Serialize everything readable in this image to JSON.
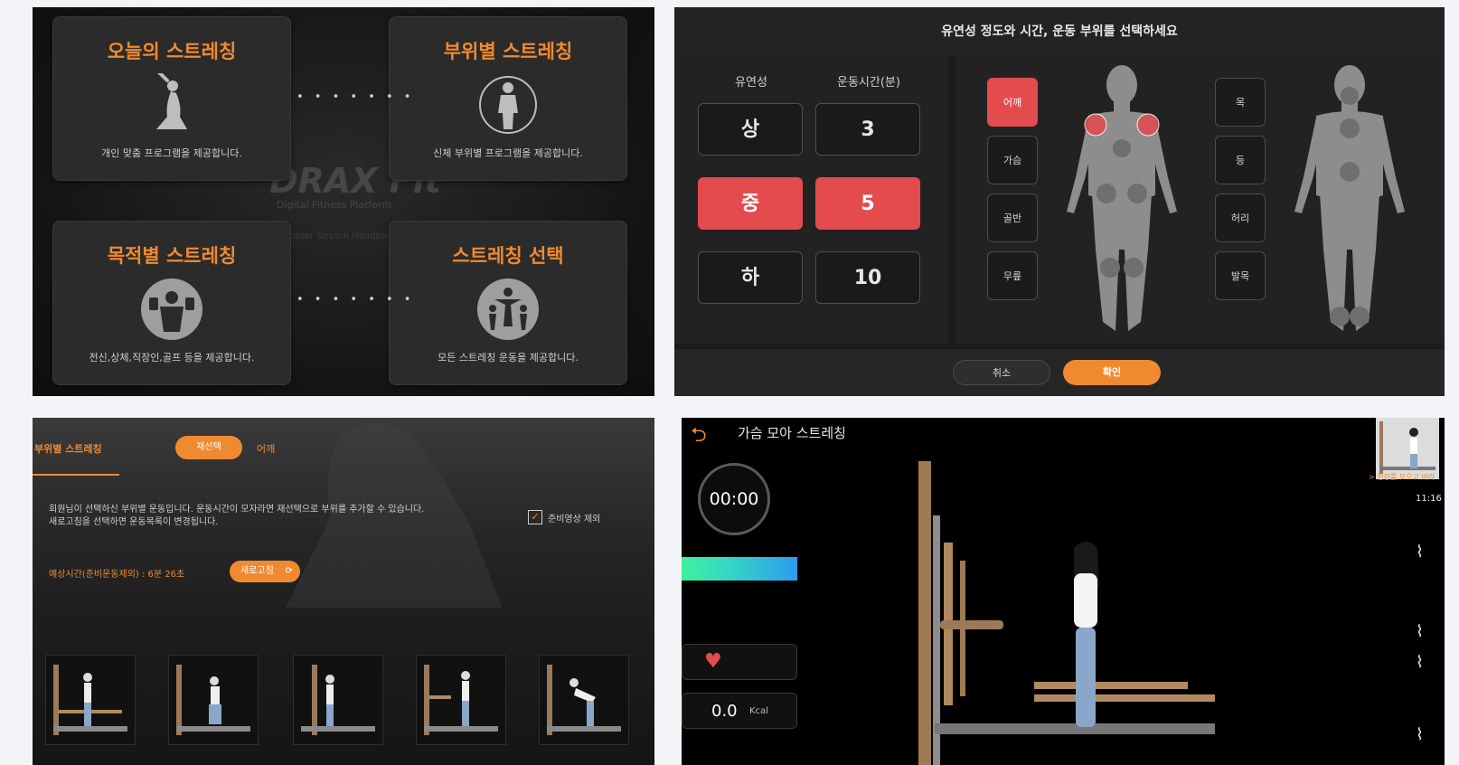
{
  "colors": {
    "accent_orange": "#f08a30",
    "accent_red": "#e34b4f",
    "panel_dark": "#1c1c1c"
  },
  "menu": {
    "cards": [
      {
        "title": "오늘의 스트레칭",
        "desc": "개인 맞춤 프로그램을 제공합니다.",
        "icon": "yoga-pose-icon"
      },
      {
        "title": "부위별 스트레칭",
        "desc": "신체 부위별 프로그램을 제공합니다.",
        "icon": "body-rotate-icon"
      },
      {
        "title": "목적별 스트레칭",
        "desc": "전신,상체,직장인,골프 등을 제공합니다.",
        "icon": "dumbbell-person-icon"
      },
      {
        "title": "스트레칭 선택",
        "desc": "모든 스트레칭 운동을 제공합니다.",
        "icon": "group-exercise-icon"
      }
    ],
    "dots": "• • • • • • •",
    "brand": "DRAX Fit",
    "brand_sub": "Digital Fitness Platform",
    "brand_sub2": "Outdoor Stretch Handbook"
  },
  "selector": {
    "title": "유연성 정도와 시간, 운동 부위를 선택하세요",
    "flex_header": "유연성",
    "time_header": "운동시간(분)",
    "flex_options": [
      "상",
      "중",
      "하"
    ],
    "time_options": [
      "3",
      "5",
      "10"
    ],
    "selected_flex": "중",
    "selected_time": "5",
    "front_parts": [
      "어깨",
      "가슴",
      "골반",
      "무릎"
    ],
    "back_parts": [
      "목",
      "등",
      "허리",
      "발목"
    ],
    "selected_part": "어깨",
    "cancel": "취소",
    "confirm": "확인"
  },
  "program": {
    "title": "부위별 스트레칭",
    "tab_active": "재선택",
    "tab_part": "어깨",
    "notice_line1": "회원님이 선택하신 부위별 운동입니다. 운동시간이 모자라면 재선택으로 부위를 추가할 수 있습니다.",
    "notice_line2": "새로고침을 선택하면 운동목록이 변경됩니다.",
    "exclude_label": "준비영상 제외",
    "exclude_checked": true,
    "expected_time": "예상시간(준비운동제외) : 6분 26초",
    "refresh": "새로고침"
  },
  "player": {
    "title": "가슴 모아 스트레칭",
    "timer": "00:00",
    "kcal_value": "0.0",
    "kcal_unit": "Kcal",
    "side_caption": "> 천강를 모으고 바라",
    "side_time": "11:16"
  }
}
